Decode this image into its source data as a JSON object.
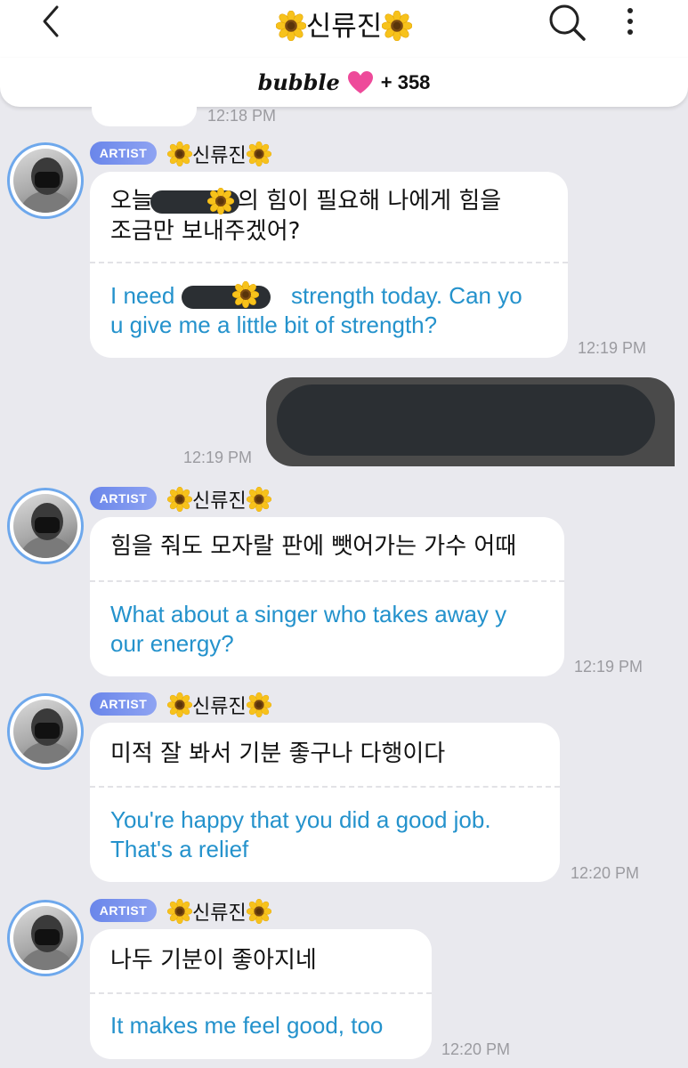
{
  "header": {
    "back_icon": "chevron-left-icon",
    "title": "신류진",
    "title_icon": "sunflower-icon",
    "search_icon": "search-icon",
    "more_icon": "more-vertical-icon"
  },
  "bubble_bar": {
    "logo": "bubble",
    "heart_icon": "heart-icon",
    "heart_color": "#ee4a9a",
    "count": "+ 358"
  },
  "colors": {
    "accent_text": "#2492cc",
    "badge": "#7a93ee",
    "avatar_ring": "#6ea8ec"
  },
  "chat": {
    "top_time": "12:18 PM",
    "messages": [
      {
        "badge": "ARTIST",
        "sender": "신류진",
        "ko": [
          "오늘",
          "의 힘이 필요해 나에게 힘을",
          "조금만 보내주겠어?"
        ],
        "en": [
          "I need",
          "strength today. Can yo",
          "u give me a little bit of strength?"
        ],
        "time": "12:19 PM"
      },
      {
        "mine": true,
        "time": "12:19 PM"
      },
      {
        "badge": "ARTIST",
        "sender": "신류진",
        "ko": [
          "힘을 줘도 모자랄 판에 뺏어가는 가수 어때"
        ],
        "en": [
          "What about a singer who takes away y",
          "our energy?"
        ],
        "time": "12:19 PM"
      },
      {
        "badge": "ARTIST",
        "sender": "신류진",
        "ko": [
          "미적 잘 봐서 기분 좋구나 다행이다"
        ],
        "en": [
          "You're happy that you did a good job.",
          "That's a relief"
        ],
        "time": "12:20 PM"
      },
      {
        "badge": "ARTIST",
        "sender": "신류진",
        "ko": [
          "나두 기분이 좋아지네"
        ],
        "en": [
          "It makes me feel good, too"
        ],
        "time": "12:20 PM"
      }
    ]
  }
}
